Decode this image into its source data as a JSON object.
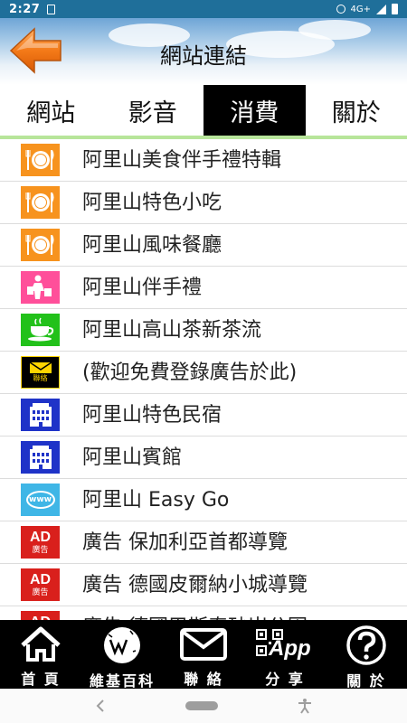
{
  "status": {
    "time": "2:27",
    "network": "4G+"
  },
  "header": {
    "title": "網站連結",
    "back_icon": "orange-left-arrow"
  },
  "tabs": [
    {
      "label": "網站",
      "active": false
    },
    {
      "label": "影音",
      "active": false
    },
    {
      "label": "消費",
      "active": true
    },
    {
      "label": "關於",
      "active": false
    }
  ],
  "list": [
    {
      "label": "阿里山美食伴手禮特輯",
      "icon": "dining-icon",
      "color": "#f7931e"
    },
    {
      "label": "阿里山特色小吃",
      "icon": "dining-icon",
      "color": "#f7931e"
    },
    {
      "label": "阿里山風味餐廳",
      "icon": "dining-icon",
      "color": "#f7931e"
    },
    {
      "label": "阿里山伴手禮",
      "icon": "shopping-icon",
      "color": "#ff4f9a"
    },
    {
      "label": "阿里山高山茶新茶流",
      "icon": "tea-cup-icon",
      "color": "#22c11a"
    },
    {
      "label": "(歡迎免費登錄廣告於此)",
      "icon": "contact-mail-icon",
      "color": "#000000",
      "icon_text": "聯絡"
    },
    {
      "label": "阿里山特色民宿",
      "icon": "building-icon",
      "color": "#1f33c8"
    },
    {
      "label": "阿里山賓館",
      "icon": "building-icon",
      "color": "#1f33c8"
    },
    {
      "label": "阿里山 Easy Go",
      "icon": "www-icon",
      "color": "#3fb6e6",
      "icon_text": "www"
    },
    {
      "label": "廣告 保加利亞首都導覽",
      "icon": "ad-icon",
      "color": "#d9201c",
      "icon_text": "AD",
      "icon_sub": "廣告"
    },
    {
      "label": "廣告 德國皮爾納小城導覽",
      "icon": "ad-icon",
      "color": "#d9201c",
      "icon_text": "AD",
      "icon_sub": "廣告"
    },
    {
      "label": "廣告 德國巴斯泰砂岩公園",
      "icon": "ad-icon",
      "color": "#d9201c",
      "icon_text": "AD",
      "icon_sub": "廣告"
    }
  ],
  "bottom_nav": [
    {
      "label": "首 頁",
      "icon": "home-icon"
    },
    {
      "label": "維基百科",
      "icon": "wikipedia-icon"
    },
    {
      "label": "聯 絡",
      "icon": "mail-icon"
    },
    {
      "label": "分 享",
      "icon": "qr-app-icon",
      "icon_text": "App"
    },
    {
      "label": "關 於",
      "icon": "help-icon"
    }
  ]
}
